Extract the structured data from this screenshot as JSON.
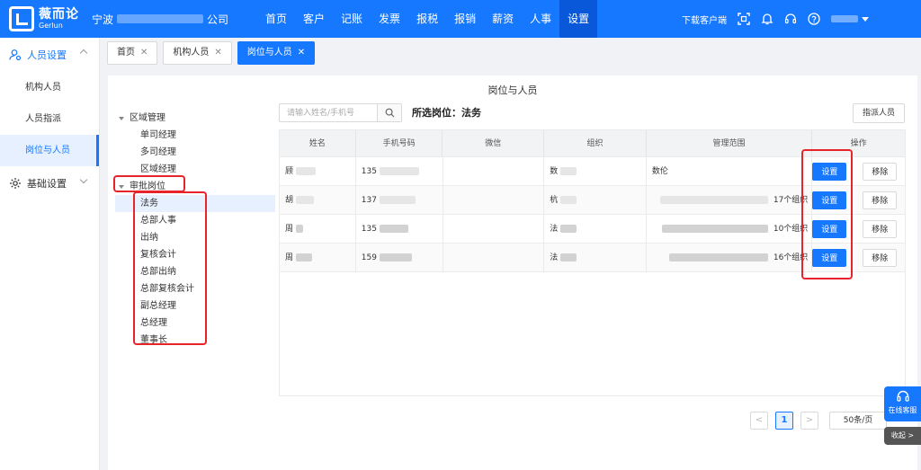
{
  "header": {
    "logo_cn": "薇而论",
    "logo_en": "Gerlun",
    "company_prefix": "宁波",
    "company_suffix": "公司",
    "nav": [
      "首页",
      "客户",
      "记账",
      "发票",
      "报税",
      "报销",
      "薪资",
      "人事",
      "设置"
    ],
    "nav_active_index": 8,
    "download_client": "下载客户端"
  },
  "sidebar": {
    "group1": "人员设置",
    "items": [
      "机构人员",
      "人员指派",
      "岗位与人员"
    ],
    "active_item": "岗位与人员",
    "group2": "基础设置"
  },
  "tabs": [
    {
      "label": "首页",
      "active": false
    },
    {
      "label": "机构人员",
      "active": false
    },
    {
      "label": "岗位与人员",
      "active": true
    }
  ],
  "panel": {
    "title": "岗位与人员",
    "tree": {
      "root1": "区域管理",
      "root1_children": [
        "单司经理",
        "多司经理",
        "区域经理"
      ],
      "root2": "审批岗位",
      "root2_children": [
        "法务",
        "总部人事",
        "出纳",
        "复核会计",
        "总部出纳",
        "总部复核会计",
        "副总经理",
        "总经理",
        "董事长"
      ],
      "selected": "法务"
    },
    "search_placeholder": "请输入姓名/手机号",
    "selected_post": "所选岗位：法务",
    "assign_button": "指派人员",
    "table": {
      "columns": [
        "姓名",
        "手机号码",
        "微信",
        "组织",
        "管理范围",
        "操作"
      ],
      "rows": [
        {
          "name": "顾",
          "phone": "135",
          "wechat": "",
          "org": "数",
          "scope": "数伦",
          "scope_suffix": ""
        },
        {
          "name": "胡",
          "phone": "137",
          "wechat": "",
          "org": "杭",
          "scope": "",
          "scope_suffix": "17个组织"
        },
        {
          "name": "周",
          "phone": "135",
          "wechat": "",
          "org": "法",
          "scope": "",
          "scope_suffix": "10个组织"
        },
        {
          "name": "周",
          "phone": "159",
          "wechat": "",
          "org": "法",
          "scope": "",
          "scope_suffix": "16个组织"
        }
      ],
      "set_label": "设置",
      "remove_label": "移除"
    },
    "pager": {
      "prev": "<",
      "current": "1",
      "next": ">",
      "page_size": "50条/页"
    }
  },
  "float": {
    "service": "在线客服",
    "collapse": "收起 >"
  },
  "colors": {
    "primary": "#1677ff",
    "highlight_red": "#e8242b"
  }
}
